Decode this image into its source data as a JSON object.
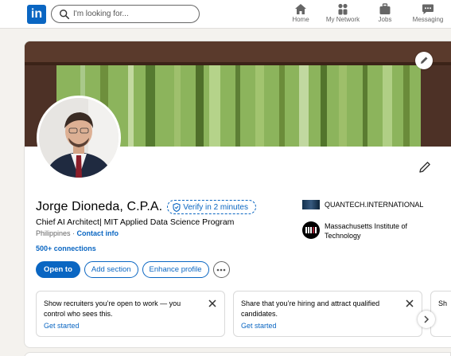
{
  "nav": {
    "logo_text": "in",
    "search_placeholder": "I'm looking for...",
    "items": [
      {
        "label": "Home",
        "icon": "home-icon"
      },
      {
        "label": "My Network",
        "icon": "people-icon"
      },
      {
        "label": "Jobs",
        "icon": "briefcase-icon"
      },
      {
        "label": "Messaging",
        "icon": "message-icon"
      }
    ]
  },
  "profile": {
    "name": "Jorge Dioneda, C.P.A.",
    "verify_label": "Verify in 2 minutes",
    "headline": "Chief AI Architect| MIT Applied Data Science Program",
    "location": "Philippines",
    "separator": " · ",
    "contact_info": "Contact info",
    "connections": "500+ connections",
    "orgs": [
      {
        "name": "QUANTECH.INTERNATIONAL",
        "logo": "quantech-logo"
      },
      {
        "name": "Massachusetts Institute of Technology",
        "logo": "mit-logo"
      }
    ],
    "buttons": {
      "open_to": "Open to",
      "add_section": "Add section",
      "enhance_profile": "Enhance profile"
    }
  },
  "tips": [
    {
      "text": "Show recruiters you’re open to work — you control who sees this.",
      "link": "Get started"
    },
    {
      "text": "Share that you’re hiring and attract qualified candidates.",
      "link": "Get started"
    },
    {
      "text": "Sh",
      "link": ""
    }
  ],
  "colors": {
    "brand": "#0a66c2",
    "background": "#f4f2ee"
  }
}
